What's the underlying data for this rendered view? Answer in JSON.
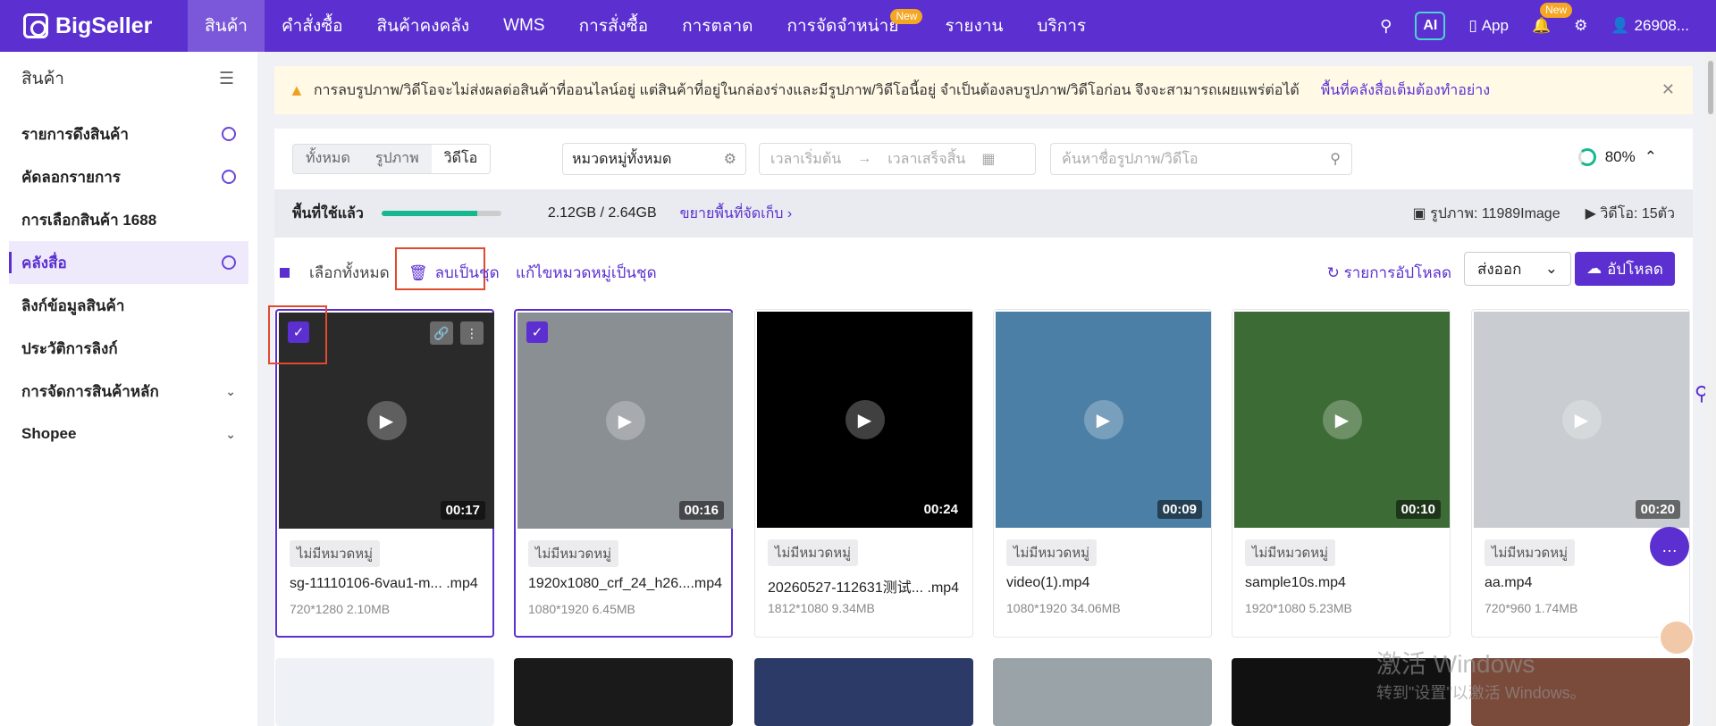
{
  "brand": {
    "name": "BigSeller",
    "color": "#5b2fd0"
  },
  "nav": {
    "items": [
      {
        "label": "สินค้า",
        "active": true
      },
      {
        "label": "คำสั่งซื้อ"
      },
      {
        "label": "สินค้าคงคลัง"
      },
      {
        "label": "WMS"
      },
      {
        "label": "การสั่งซื้อ"
      },
      {
        "label": "การตลาด"
      },
      {
        "label": "การจัดจำหน่าย",
        "badge": "New"
      },
      {
        "label": "รายงาน"
      },
      {
        "label": "บริการ"
      }
    ],
    "ai_label": "AI",
    "app_label": "App",
    "bell_badge": "New",
    "user": "26908..."
  },
  "sidebar": {
    "title": "สินค้า",
    "items": [
      {
        "label": "รายการดึงสินค้า",
        "icon": "gear-icon"
      },
      {
        "label": "คัดลอกรายการ",
        "icon": "gear-icon"
      },
      {
        "label": "การเลือกสินค้า 1688"
      },
      {
        "label": "คลังสื่อ",
        "icon": "gear-icon",
        "active": true
      },
      {
        "label": "ลิงก์ข้อมูลสินค้า"
      },
      {
        "label": "ประวัติการลิงก์"
      },
      {
        "label": "การจัดการสินค้าหลัก",
        "icon": "chevron-down-icon"
      },
      {
        "label": "Shopee",
        "icon": "chevron-down-icon"
      }
    ]
  },
  "alert": {
    "text": "การลบรูปภาพ/วิดีโอจะไม่ส่งผลต่อสินค้าที่ออนไลน์อยู่ แต่สินค้าที่อยู่ในกล่องร่างและมีรูปภาพ/วิดีโอนี้อยู่ จำเป็นต้องลบรูปภาพ/วิดีโอก่อน จึงจะสามารถเผยแพร่ต่อได้",
    "link": "พื้นที่คลังสื่อเต็มต้องทำอย่าง"
  },
  "filters": {
    "tabs": [
      "ทั้งหมด",
      "รูปภาพ",
      "วิดีโอ"
    ],
    "category": "หมวดหมู่ทั้งหมด",
    "date_start": "เวลาเริ่มต้น",
    "date_end": "เวลาเสร็จสิ้น",
    "search_placeholder": "ค้นหาชื่อรูปภาพ/วิดีโอ",
    "progress": "80%"
  },
  "storage": {
    "label": "พื้นที่ใช้แล้ว",
    "used_fraction": 0.8,
    "usage": "2.12GB / 2.64GB",
    "expand": "ขยายพื้นที่จัดเก็บ",
    "images": "รูปภาพ: 11989Image",
    "videos": "วิดีโอ: 15ตัว"
  },
  "actions": {
    "select_all": "เลือกทั้งหมด",
    "batch_delete": "ลบเป็นชุด",
    "batch_category": "แก้ไขหมวดหมู่เป็นชุด",
    "upload_list": "รายการอัปโหลด",
    "export": "ส่งออก",
    "upload": "อัปโหลด"
  },
  "videos": [
    {
      "duration": "00:17",
      "tag": "ไม่มีหมวดหมู่",
      "name": "sg-11110106-6vau1-m... .mp4",
      "meta": "720*1280  2.10MB",
      "selected": true,
      "thumb": "#2a2a2a"
    },
    {
      "duration": "00:16",
      "tag": "ไม่มีหมวดหมู่",
      "name": "1920x1080_crf_24_h26....mp4",
      "meta": "1080*1920  6.45MB",
      "selected": true,
      "thumb": "#8a8f94"
    },
    {
      "duration": "00:24",
      "tag": "ไม่มีหมวดหมู่",
      "name": "20260527-112631测试... .mp4",
      "meta": "1812*1080  9.34MB",
      "selected": false,
      "thumb": "#000000"
    },
    {
      "duration": "00:09",
      "tag": "ไม่มีหมวดหมู่",
      "name": "video(1).mp4",
      "meta": "1080*1920  34.06MB",
      "selected": false,
      "thumb": "#4b7fa6"
    },
    {
      "duration": "00:10",
      "tag": "ไม่มีหมวดหมู่",
      "name": "sample10s.mp4",
      "meta": "1920*1080  5.23MB",
      "selected": false,
      "thumb": "#3d6b35"
    },
    {
      "duration": "00:20",
      "tag": "ไม่มีหมวดหมู่",
      "name": "aa.mp4",
      "meta": "720*960  1.74MB",
      "selected": false,
      "thumb": "#c9ccd0"
    }
  ],
  "row2_thumbs": [
    "#eef2f7",
    "#1a1a1a",
    "#2b3a66",
    "#9aa4a8",
    "#111111",
    "#7a4a3a"
  ],
  "watermark": {
    "line1": "激活 Windows",
    "line2": "转到\"设置\"以激活 Windows。"
  }
}
